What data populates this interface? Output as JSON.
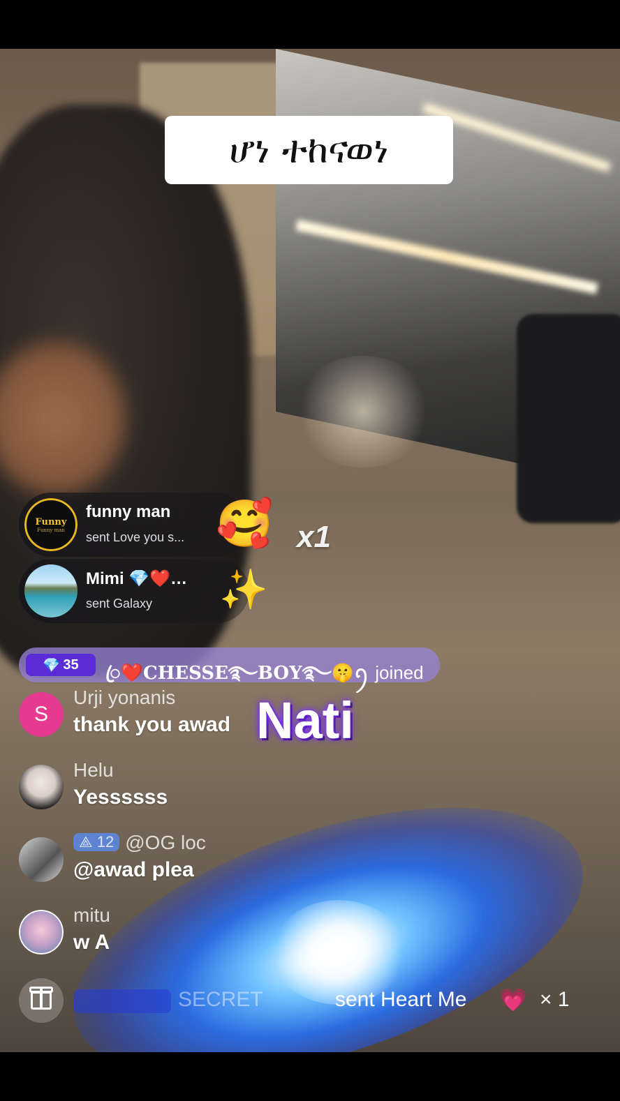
{
  "overlay": {
    "caption": "ሆነ ተከናወነ",
    "combo": "x1",
    "streamer_label": "Nati"
  },
  "gifts": [
    {
      "user": "funny man",
      "sent": "sent Love you s...",
      "avatar_text_1": "Funny",
      "avatar_text_2": "Funny man",
      "icon": "love-you-so-much-gift-icon",
      "glyph": "🥰"
    },
    {
      "user": "Mimi 💎❤️…",
      "sent": "sent Galaxy",
      "icon": "galaxy-gift-icon",
      "glyph": "✨"
    }
  ],
  "joined": {
    "level": "35",
    "level_glyph": "💎",
    "username": "ꦿ❤️CHESSE࿐BOY࿐🤫ꪆ",
    "action": "joined"
  },
  "comments": [
    {
      "name": "Urji yonanis",
      "text": "thank you awad",
      "avatar_letter": "S",
      "badge": ""
    },
    {
      "name": "Helu",
      "text": "Yessssss",
      "badge": ""
    },
    {
      "name": "@OG loc",
      "text": "@awad  plea",
      "badge": "12",
      "badge_glyph": "⟁"
    },
    {
      "name": "mitu",
      "text": "w A",
      "badge": ""
    }
  ],
  "bottom_bar": {
    "gift_button": "gift-icon",
    "gift_user": "SECRET",
    "gift_text": "sent Heart Me",
    "gift_glyph": "💗",
    "gift_count": "× 1"
  },
  "colors": {
    "joined_banner": "#9682d2",
    "level_badge": "#5b2bd6",
    "avatar_s": "#e53a8f"
  }
}
